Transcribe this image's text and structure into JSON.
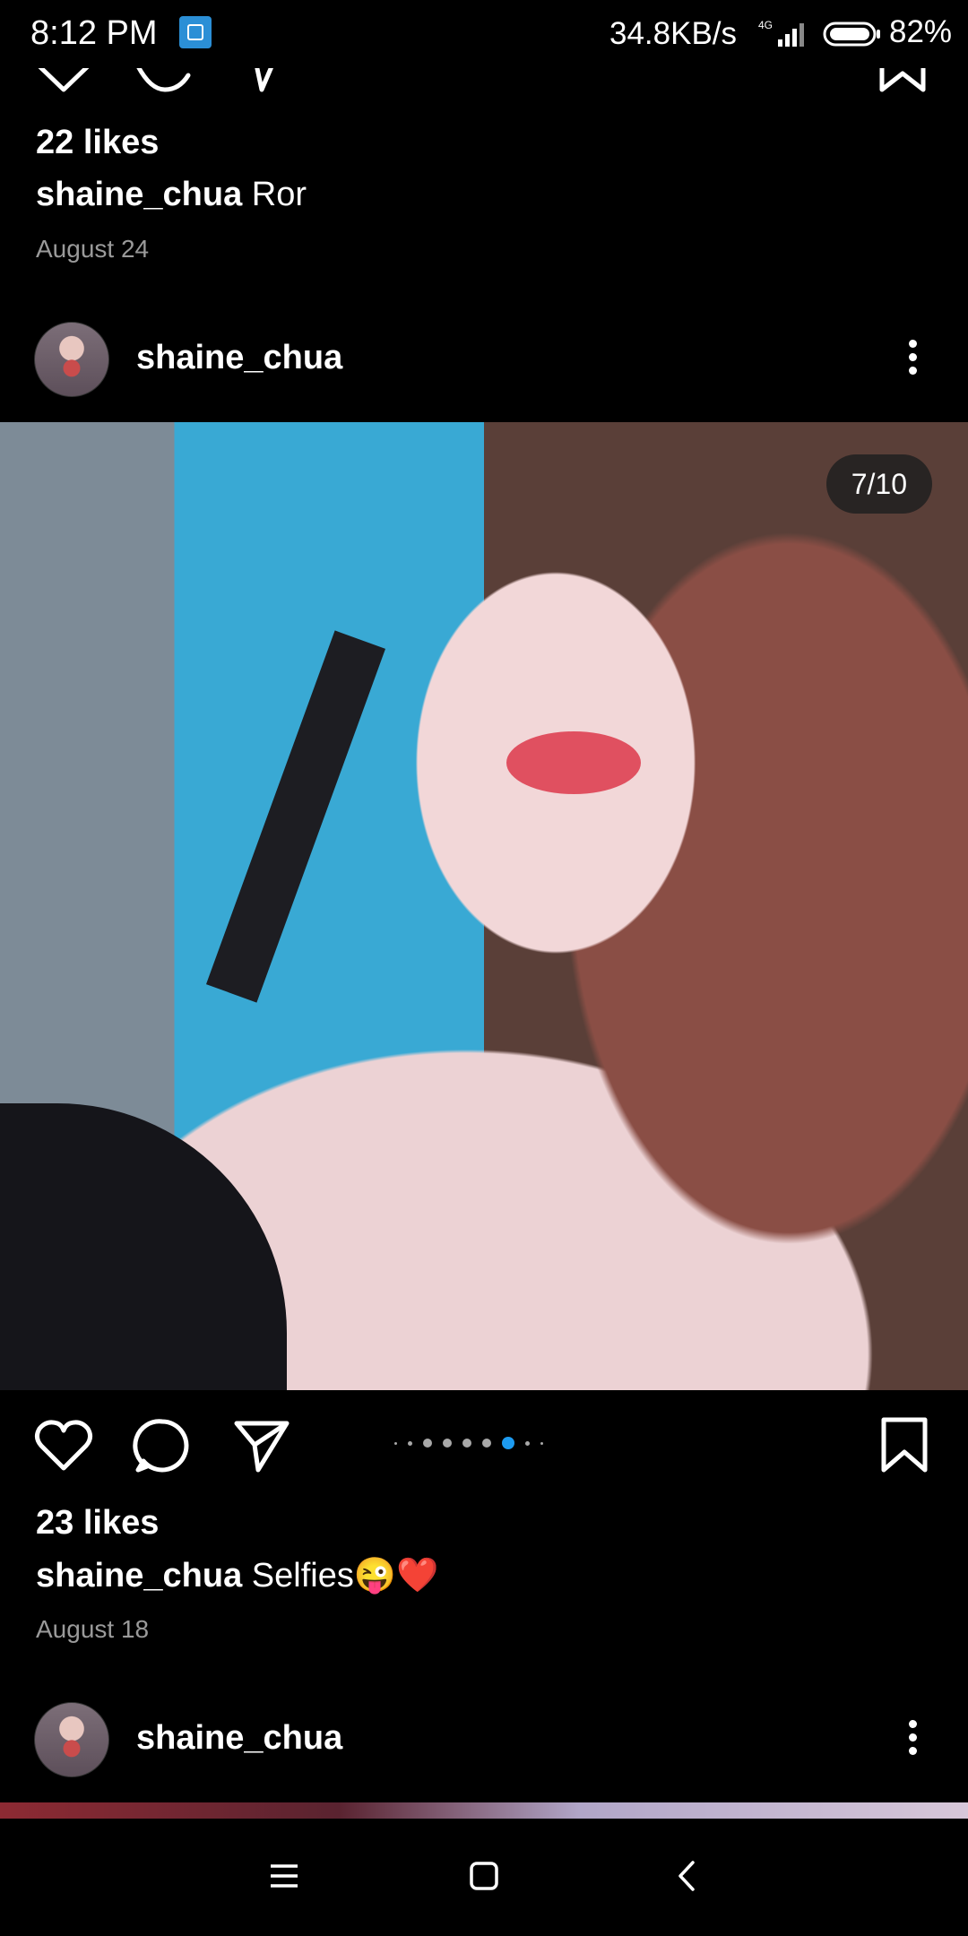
{
  "status_bar": {
    "time": "8:12 PM",
    "network_speed": "34.8KB/s",
    "network_type": "4G",
    "battery": "82%",
    "icons": [
      "app-notification-icon",
      "signal-icon",
      "battery-icon"
    ]
  },
  "previous_post": {
    "likes": "22 likes",
    "username": "shaine_chua",
    "caption": "Ror",
    "date": "August 24"
  },
  "post": {
    "username": "shaine_chua",
    "image_counter": "7/10",
    "current_image": 7,
    "total_images": 10,
    "likes": "23 likes",
    "caption_username": "shaine_chua",
    "caption": "Selfies😜❤️",
    "date": "August 18",
    "actions": [
      "like-icon",
      "comment-icon",
      "share-icon",
      "bookmark-icon"
    ],
    "accent_color": "#1d9bf0"
  },
  "next_post": {
    "username": "shaine_chua"
  },
  "nav_bar": {
    "icons": [
      "menu-icon",
      "home-icon",
      "back-icon"
    ]
  }
}
